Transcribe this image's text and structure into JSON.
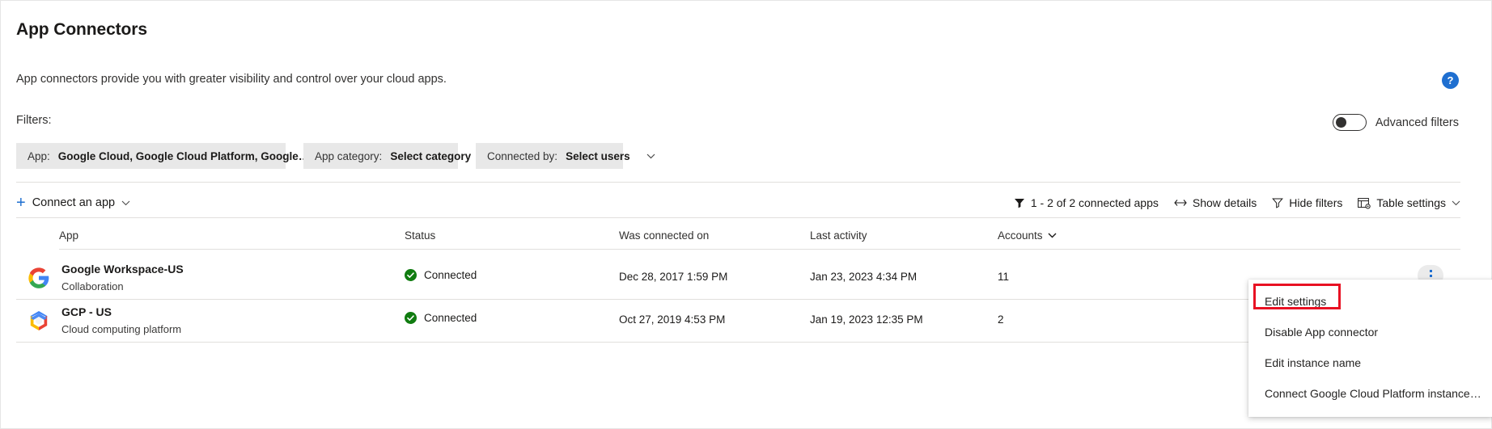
{
  "header": {
    "title": "App Connectors",
    "subtitle": "App connectors provide you with greater visibility and control over your cloud apps.",
    "help_icon_label": "?"
  },
  "filters": {
    "label": "Filters:",
    "advanced_filters_label": "Advanced filters",
    "advanced_filters_on": false,
    "chips": [
      {
        "label": "App:",
        "value": "Google Cloud, Google Cloud Platform, Google…"
      },
      {
        "label": "App category:",
        "value": "Select category"
      },
      {
        "label": "Connected by:",
        "value": "Select users"
      }
    ]
  },
  "toolbar": {
    "connect_app_label": "Connect an app",
    "count_label": "1 - 2 of 2 connected apps",
    "show_details_label": "Show details",
    "hide_filters_label": "Hide filters",
    "table_settings_label": "Table settings"
  },
  "table": {
    "columns": {
      "app": "App",
      "status": "Status",
      "was_connected_on": "Was connected on",
      "last_activity": "Last activity",
      "accounts": "Accounts"
    },
    "rows": [
      {
        "icon": "google-g-icon",
        "name": "Google Workspace-US",
        "category": "Collaboration",
        "status": "Connected",
        "was_connected_on": "Dec 28, 2017 1:59 PM",
        "last_activity": "Jan 23, 2023 4:34 PM",
        "accounts": "11"
      },
      {
        "icon": "google-cloud-icon",
        "name": "GCP - US",
        "category": "Cloud computing platform",
        "status": "Connected",
        "was_connected_on": "Oct 27, 2019 4:53 PM",
        "last_activity": "Jan 19, 2023 12:35 PM",
        "accounts": "2"
      }
    ]
  },
  "context_menu": {
    "items": [
      "Edit settings",
      "Disable App connector",
      "Edit instance name",
      "Connect Google Cloud Platform instance…"
    ],
    "highlighted_index": 0
  },
  "colors": {
    "accent": "#1f6fd0",
    "status_connected": "#107c10",
    "highlight_box": "#e81123",
    "chip_bg": "#e8e8e8"
  }
}
